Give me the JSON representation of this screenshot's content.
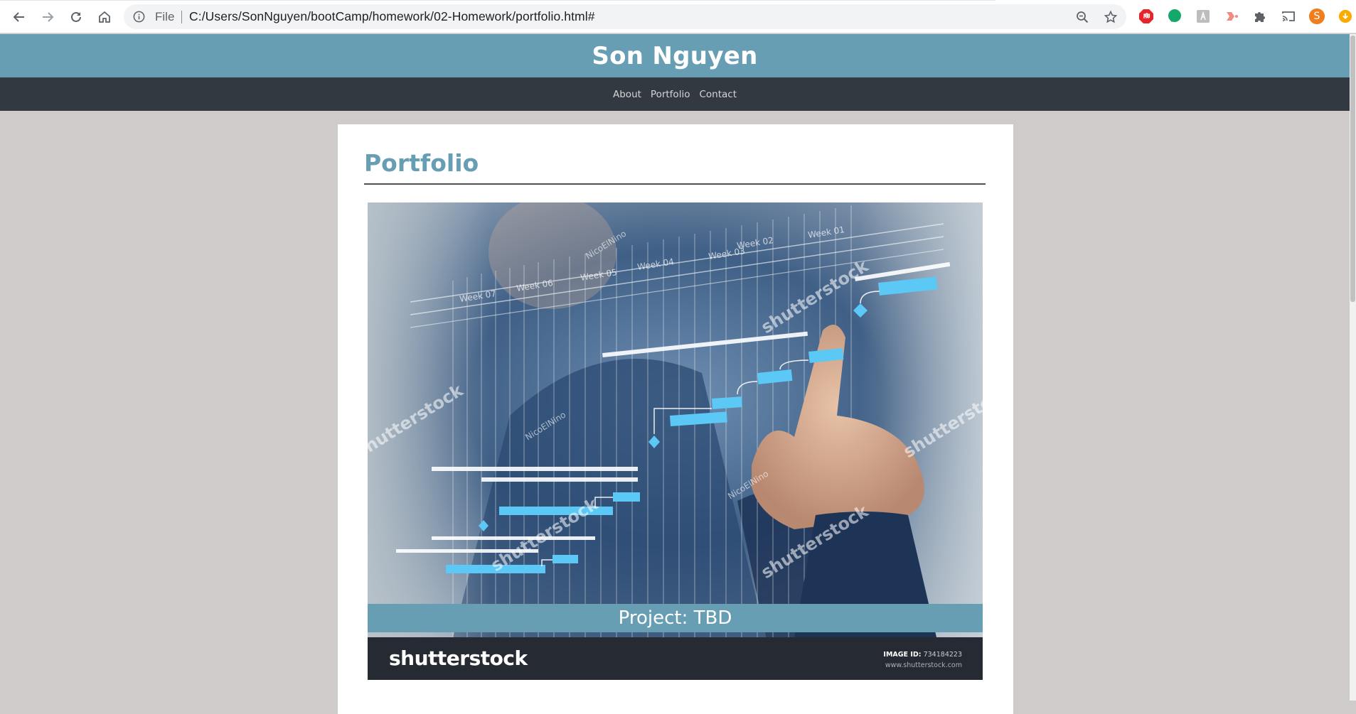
{
  "browser": {
    "file_label": "File",
    "url": "C:/Users/SonNguyen/bootCamp/homework/02-Homework/portfolio.html#",
    "profile_initial": "S",
    "icons": [
      "back-icon",
      "forward-icon",
      "reload-icon",
      "home-icon",
      "info-icon",
      "zoom-icon",
      "star-icon",
      "adblock-icon",
      "grammarly-icon",
      "extension-icon",
      "cast-icon",
      "puzzle-icon",
      "profile-avatar"
    ]
  },
  "site": {
    "title": "Son Nguyen",
    "nav": [
      "About",
      "Portfolio",
      "Contact"
    ]
  },
  "portfolio": {
    "heading": "Portfolio",
    "project_caption": "Project: TBD",
    "image": {
      "watermark": "shutterstock",
      "author_watermark": "NicoElNino",
      "footer_logo": "shutterstock",
      "image_id_label": "IMAGE ID:",
      "image_id_value": "734184223",
      "site": "www.shutterstock.com",
      "week_labels": [
        "Week 01",
        "Week 02",
        "Week 03",
        "Week 04",
        "Week 05",
        "Week 06",
        "Week 07"
      ]
    }
  },
  "colors": {
    "header_bg": "#679eb3",
    "nav_bg": "#333940",
    "page_bg": "#cfcbca",
    "accent": "#679eb3",
    "gantt_bar": "#5bc8f5"
  }
}
